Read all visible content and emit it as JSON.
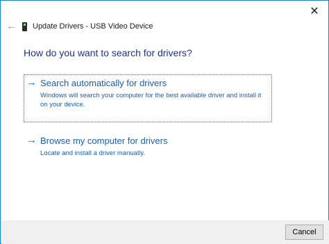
{
  "window": {
    "title": "Update Drivers - USB Video Device",
    "close_glyph": "✕",
    "back_glyph": "←",
    "accent_color": "#1883d7"
  },
  "main": {
    "heading": "How do you want to search for drivers?",
    "options": [
      {
        "arrow": "→",
        "title": "Search automatically for drivers",
        "description": "Windows will search your computer for the best available driver and install it on your device."
      },
      {
        "arrow": "→",
        "title": "Browse my computer for drivers",
        "description": "Locate and install a driver manually."
      }
    ]
  },
  "footer": {
    "cancel_label": "Cancel"
  },
  "icons": {
    "device": "usb-video-device-icon",
    "back": "back-arrow-icon",
    "close": "close-icon",
    "option_arrow": "arrow-right-icon"
  }
}
